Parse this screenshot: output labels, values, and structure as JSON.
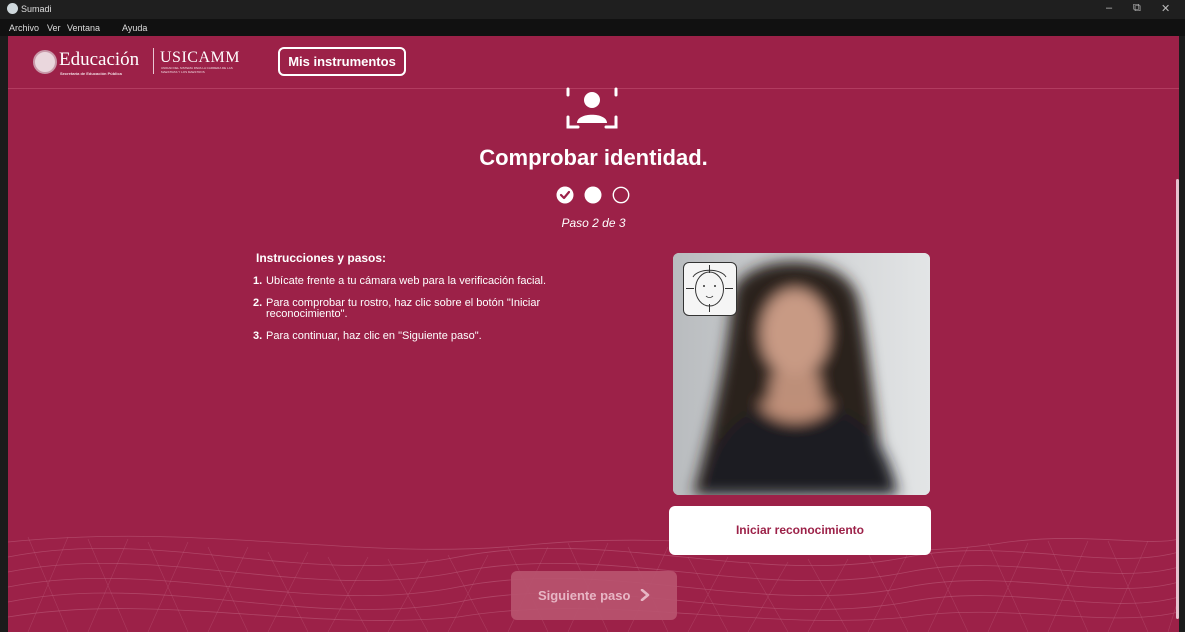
{
  "window": {
    "title": "Sumadi",
    "minimize": "–",
    "restore": "⧉",
    "close": "✕"
  },
  "menu": [
    "Archivo",
    "Ver",
    "Ventana",
    "Ayuda"
  ],
  "header": {
    "logo_edu": "Educación",
    "logo_edu_sub": "Secretaría de Educación Pública",
    "logo_usicamm": "USICAMM",
    "logo_usicamm_sub": "Unidad del Sistema para la Carrera de las Maestras y los Maestros",
    "mis_instrumentos": "Mis instrumentos"
  },
  "main": {
    "title": "Comprobar identidad.",
    "step_label": "Paso 2 de 3",
    "steps": {
      "completed": 1,
      "current": 2,
      "total": 3
    },
    "instructions_title": "Instrucciones y pasos:",
    "instructions": [
      {
        "num": "1.",
        "text": "Ubícate frente a tu cámara web para la verificación facial."
      },
      {
        "num": "2.",
        "text": "Para comprobar tu rostro, haz clic sobre el botón \"Iniciar reconocimiento\"."
      },
      {
        "num": "3.",
        "text": "Para continuar, haz clic en \"Siguiente paso\"."
      }
    ],
    "recognition_button": "Iniciar reconocimiento",
    "next_button": "Siguiente paso"
  },
  "colors": {
    "brand": "#9c2148",
    "white": "#ffffff",
    "disabled_button": "#b9546f"
  }
}
